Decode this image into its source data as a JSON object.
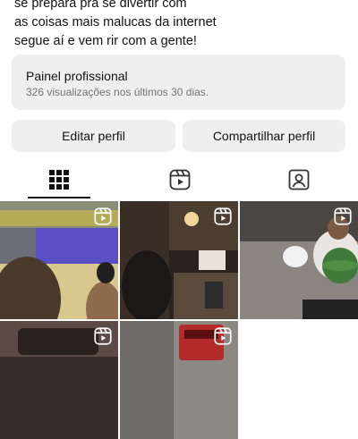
{
  "bio": {
    "lines": [
      "se prepara pra se divertir com",
      "as coisas mais malucas da internet",
      "segue aí e vem rir com a gente!"
    ]
  },
  "professional_panel": {
    "title": "Painel profissional",
    "subtitle": "326 visualizações nos últimos 30 dias."
  },
  "buttons": {
    "edit": "Editar perfil",
    "share": "Compartilhar perfil"
  },
  "tabs": [
    {
      "icon": "grid-icon",
      "selected": true
    },
    {
      "icon": "reels-icon",
      "selected": false
    },
    {
      "icon": "tagged-icon",
      "selected": false
    }
  ],
  "posts": [
    {
      "type": "reel"
    },
    {
      "type": "reel"
    },
    {
      "type": "reel"
    },
    {
      "type": "reel"
    },
    {
      "type": "reel"
    }
  ]
}
